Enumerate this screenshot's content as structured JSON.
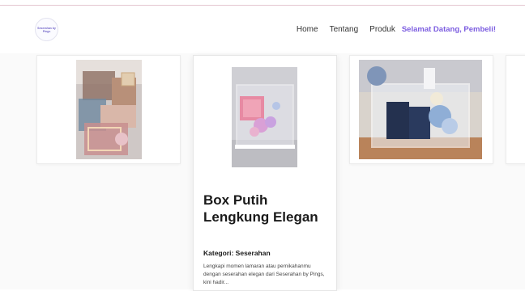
{
  "navbar": {
    "logo_text": "Seserahan by Pings",
    "links": [
      "Home",
      "Tentang",
      "Produk"
    ],
    "welcome": "Selamat Datang, Pembeli!"
  },
  "featured": {
    "title": "Box Putih Lengkung Elegan",
    "category": "Kategori: Seserahan",
    "description": "Lengkapi momen lamaran atau pernikahanmu dengan seserahan elegan dari Seserahan by Pings, kini hadir..."
  },
  "colors": {
    "accent": "#7b5ce0",
    "top_line": "#e7c9d3"
  }
}
